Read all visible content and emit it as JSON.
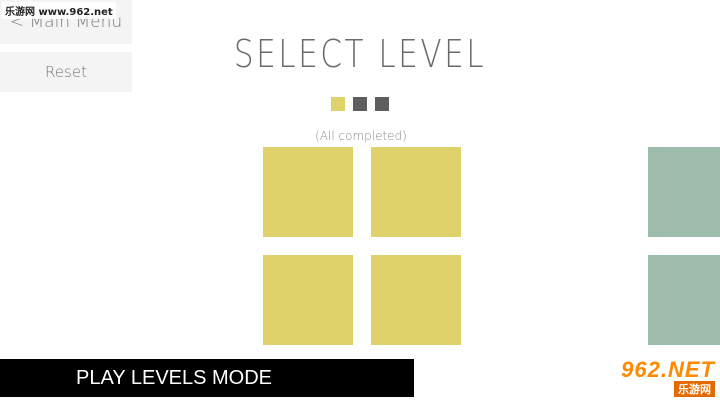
{
  "watermark": {
    "top_text": "乐游网 www.962.net",
    "logo_main": "962.NET",
    "logo_sub": "乐游网"
  },
  "nav": {
    "main_menu_label": "< Main Menu",
    "reset_label": "Reset"
  },
  "title": "SELECT LEVEL",
  "page_indicator": {
    "pages": 3,
    "active_index": 0,
    "active_color": "#e0d26a",
    "inactive_color": "#5e5e5e"
  },
  "status_text": "(All completed)",
  "tiles": [
    {
      "color": "#e0d26a",
      "state": "completed"
    },
    {
      "color": "#e0d26a",
      "state": "completed"
    },
    {
      "color": "#e0d26a",
      "state": "completed"
    },
    {
      "color": "#e0d26a",
      "state": "completed"
    },
    {
      "color": "#9ebcab",
      "state": "next-page"
    },
    {
      "color": "#9ebcab",
      "state": "next-page"
    }
  ],
  "banner_text": "PLAY LEVELS MODE"
}
